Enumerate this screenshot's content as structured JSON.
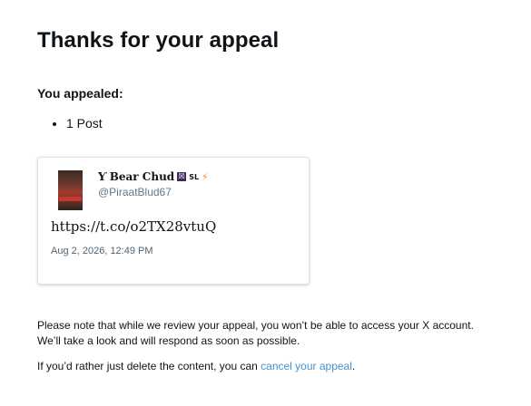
{
  "heading": "Thanks for your appeal",
  "subheading": "You appealed:",
  "appealed_items": [
    "1 Post"
  ],
  "tweet": {
    "display_name": "Ƴ Bear Chud",
    "badge_glyph": "☒",
    "badge_sl": "SL",
    "badge_bolt": "⚡",
    "handle": "@PiraatBlud67",
    "text": "https://t.co/o2TX28vtuQ",
    "timestamp": "Aug 2, 2026, 12:49 PM"
  },
  "notice": {
    "line1": "Please note that while we review your appeal, you won’t be able to access your X account.",
    "line2": "We’ll take a look and will respond as soon as possible.",
    "delete_prefix": "If you’d rather just delete the content, you can ",
    "cancel_link": "cancel your appeal",
    "delete_suffix": "."
  },
  "colors": {
    "link": "#4a90c8",
    "text": "#0f1419",
    "muted": "#657786"
  }
}
